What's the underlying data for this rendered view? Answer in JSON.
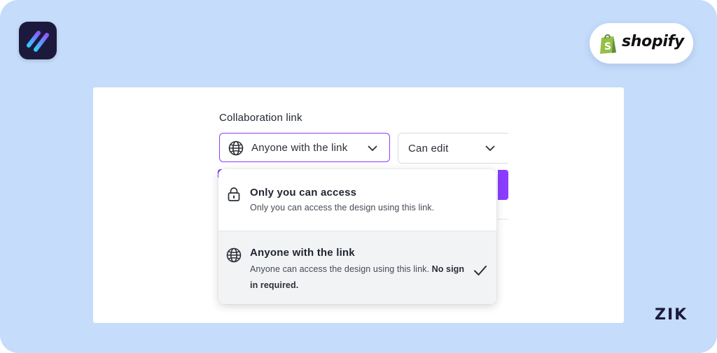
{
  "brand": {
    "app_logo_icon": "slash-stripes-logo-icon",
    "partner_logo_text": "shopify",
    "partner_logo_icon": "shopify-bag-icon",
    "footer_logo_text": "ZIK"
  },
  "collab": {
    "title": "Collaboration link",
    "access_select": {
      "icon": "globe-icon",
      "value": "Anyone with the link"
    },
    "permission_select": {
      "value": "Can edit"
    }
  },
  "dropdown": {
    "options": [
      {
        "icon": "lock-icon",
        "title": "Only you can access",
        "description": "Only you can access the design using this link.",
        "selected": false
      },
      {
        "icon": "globe-icon",
        "title": "Anyone with the link",
        "description": "Anyone can access the design using this link.",
        "description_bold": "No sign in required.",
        "selected": true
      }
    ]
  },
  "colors": {
    "background": "#c5dcfb",
    "accent": "#8b3dff",
    "logo_dark": "#1c1a3c",
    "shopify_green": "#95bf47"
  }
}
